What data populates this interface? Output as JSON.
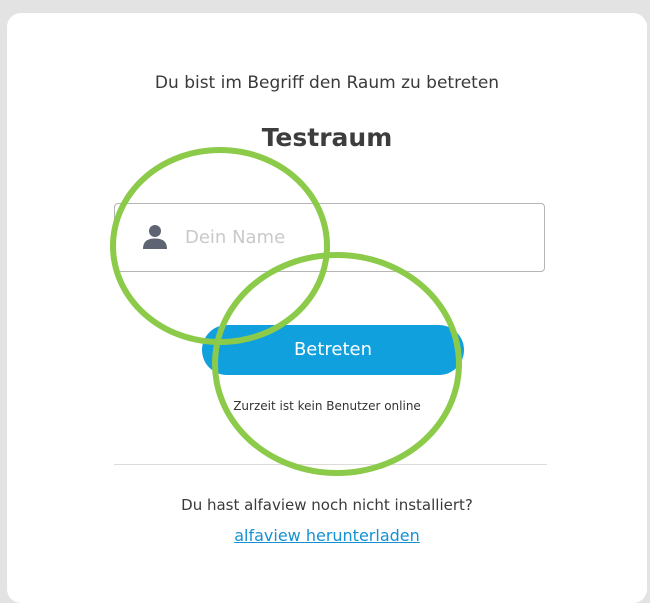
{
  "login": {
    "intro_text": "Du bist im Begriff den Raum zu betreten",
    "room_name": "Testraum",
    "name_field": {
      "value": "",
      "placeholder": "Dein Name",
      "icon": "user-icon"
    },
    "enter_button_label": "Betreten",
    "online_status": "Zurzeit ist kein Benutzer online",
    "not_installed_text": "Du hast alfaview noch nicht installiert?",
    "download_link_label": "alfaview herunterladen"
  },
  "annotations": {
    "highlight_color": "#8cca4a"
  },
  "colors": {
    "primary_button": "#11a0de",
    "link": "#1491d2",
    "page_background": "#e3e3e3",
    "card_background": "#ffffff"
  }
}
